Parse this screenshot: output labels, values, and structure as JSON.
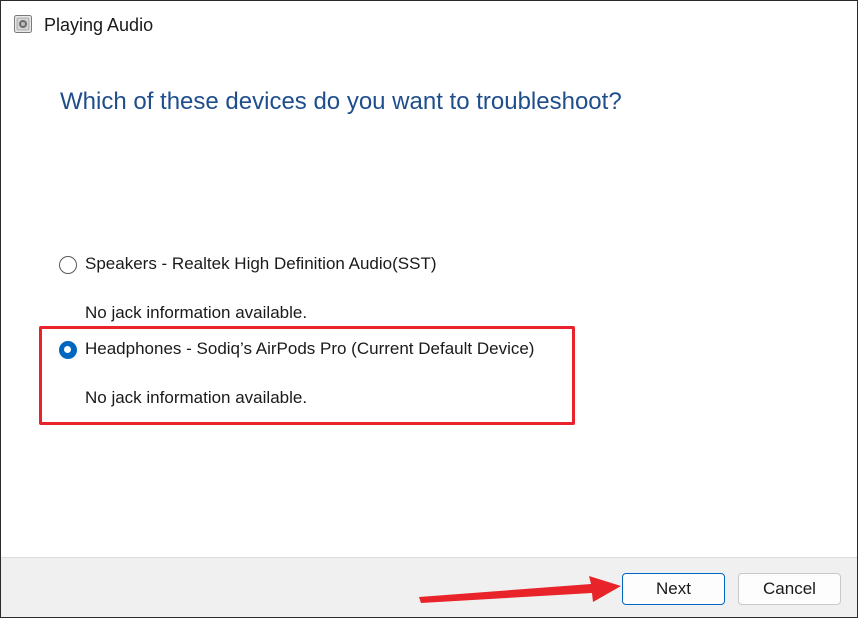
{
  "window": {
    "title": "Playing Audio"
  },
  "heading": "Which of these devices do you want to troubleshoot?",
  "devices": [
    {
      "label": "Speakers - Realtek High Definition Audio(SST)",
      "info": "No jack information available.",
      "selected": false
    },
    {
      "label": "Headphones - Sodiq’s AirPods Pro (Current Default Device)",
      "info": "No jack information available.",
      "selected": true
    }
  ],
  "buttons": {
    "next_label": "Next",
    "cancel_label": "Cancel"
  },
  "colors": {
    "heading": "#1f4e8c",
    "accent": "#0067c0",
    "annotation": "#e8232a"
  },
  "icons": {
    "app": "troubleshooter-speaker-icon"
  }
}
